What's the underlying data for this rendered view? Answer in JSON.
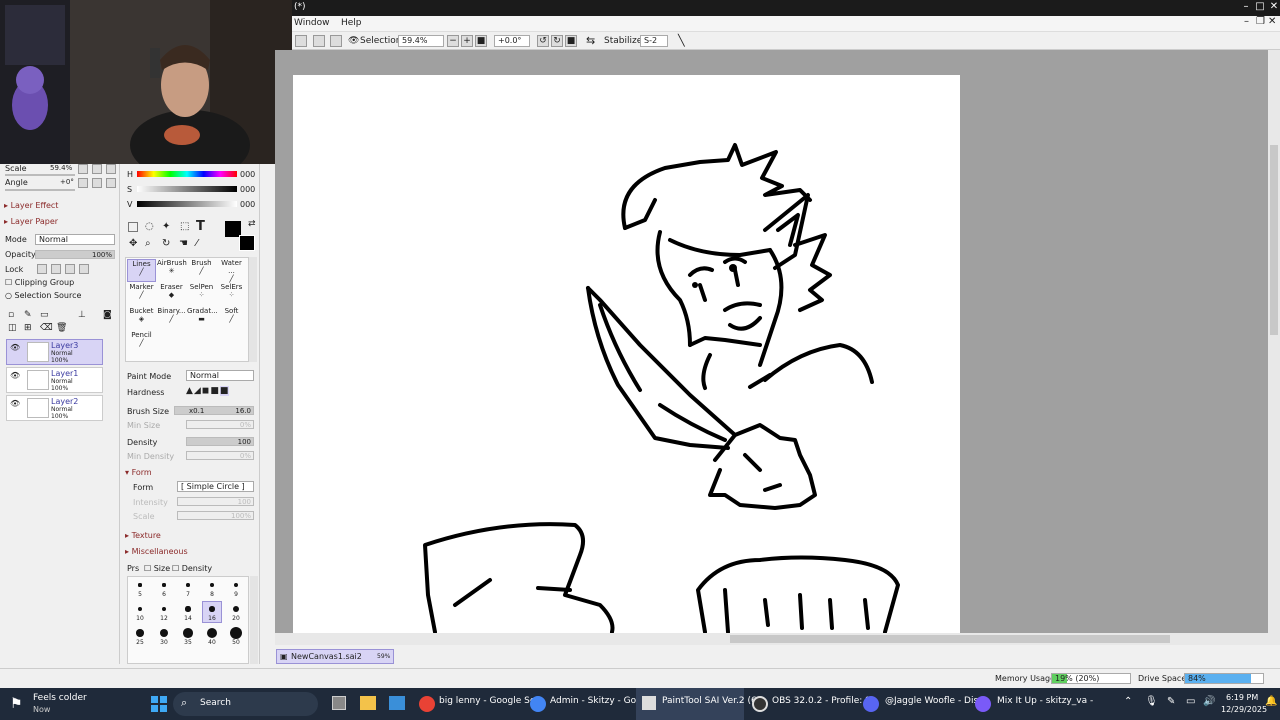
{
  "window": {
    "title": "(*)",
    "menu": [
      "Window",
      "Help"
    ]
  },
  "toolbar": {
    "selection_label": "Selection",
    "zoom": "59.4%",
    "rotation": "+0.0°",
    "stabilizer_label": "Stabilizer",
    "stabilizer_value": "S-2"
  },
  "navigator": {
    "scale_label": "Scale",
    "scale_value": "59.4%",
    "angle_label": "Angle",
    "angle_value": "+0°"
  },
  "layer_panel": {
    "layer_effect": "Layer Effect",
    "layer_paper": "Layer Paper",
    "mode_label": "Mode",
    "mode_value": "Normal",
    "opacity_label": "Opacity",
    "opacity_value": "100%",
    "lock_label": "Lock",
    "clipping_group": "Clipping Group",
    "selection_source": "Selection Source",
    "layers": [
      {
        "name": "Layer3",
        "mode": "Normal",
        "opacity": "100%"
      },
      {
        "name": "Layer1",
        "mode": "Normal",
        "opacity": "100%"
      },
      {
        "name": "Layer2",
        "mode": "Normal",
        "opacity": "100%"
      }
    ]
  },
  "color": {
    "h_label": "H",
    "h_value": "000",
    "s_label": "S",
    "s_value": "000",
    "v_label": "V",
    "v_value": "000",
    "fg": "#000000",
    "bg": "#000000"
  },
  "tools": [
    {
      "label": "Lines"
    },
    {
      "label": "AirBrush"
    },
    {
      "label": "Brush"
    },
    {
      "label": "Water ..."
    },
    {
      "label": "Marker"
    },
    {
      "label": "Eraser"
    },
    {
      "label": "SelPen"
    },
    {
      "label": "SelErs"
    },
    {
      "label": "Bucket"
    },
    {
      "label": "Binary..."
    },
    {
      "label": "Gradat..."
    },
    {
      "label": "Soft"
    },
    {
      "label": "Pencil"
    }
  ],
  "tool_settings": {
    "paint_mode_label": "Paint Mode",
    "paint_mode_value": "Normal",
    "hardness_label": "Hardness",
    "brush_size_label": "Brush Size",
    "brush_size_mult": "x0.1",
    "brush_size_value": "16.0",
    "min_size_label": "Min Size",
    "min_size_value": "0%",
    "density_label": "Density",
    "density_value": "100",
    "min_density_label": "Min Density",
    "min_density_value": "0%",
    "form_section": "Form",
    "form_label": "Form",
    "form_value": "[ Simple Circle ]",
    "intensity_label": "Intensity",
    "intensity_value": "100",
    "scale_label": "Scale",
    "scale_value": "100%",
    "texture_section": "Texture",
    "misc_section": "Miscellaneous",
    "prs_label": "Prs",
    "size_label": "Size",
    "density_chk_label": "Density",
    "brush_sizes": [
      "5",
      "6",
      "7",
      "8",
      "9",
      "10",
      "12",
      "14",
      "16",
      "20",
      "25",
      "30",
      "35",
      "40",
      "50"
    ]
  },
  "document": {
    "tab_name": "NewCanvas1.sai2",
    "tab_zoom": "59%"
  },
  "status": {
    "memory_label": "Memory Usage",
    "memory_value": "19% (20%)",
    "memory_fraction": 0.19,
    "drive_label": "Drive Space",
    "drive_value": "84%",
    "drive_fraction": 0.84
  },
  "taskbar": {
    "weather_title": "Feels colder",
    "weather_sub": "Now",
    "search": "Search",
    "apps": [
      "big lenny - Google Se",
      "Admin - Skitzy - Goog",
      "PaintTool SAI Ver.2 (6",
      "OBS 32.0.2 - Profile: S",
      "@Jaggle Woofle - Dis",
      "Mix It Up - skitzy_va -"
    ],
    "time": "6:19 PM",
    "date": "12/29/2025"
  }
}
